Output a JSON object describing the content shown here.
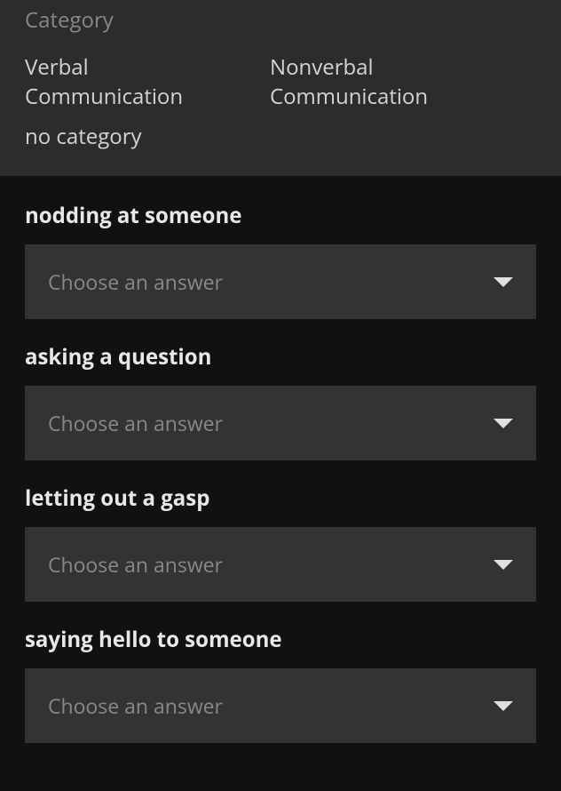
{
  "category": {
    "label": "Category",
    "options": [
      "Verbal Communication",
      "Nonverbal Communication",
      "no category"
    ]
  },
  "questions": [
    {
      "label": "nodding at someone",
      "placeholder": "Choose an answer"
    },
    {
      "label": "asking a question",
      "placeholder": "Choose an answer"
    },
    {
      "label": "letting out a gasp",
      "placeholder": "Choose an answer"
    },
    {
      "label": "saying hello to someone",
      "placeholder": "Choose an answer"
    }
  ]
}
